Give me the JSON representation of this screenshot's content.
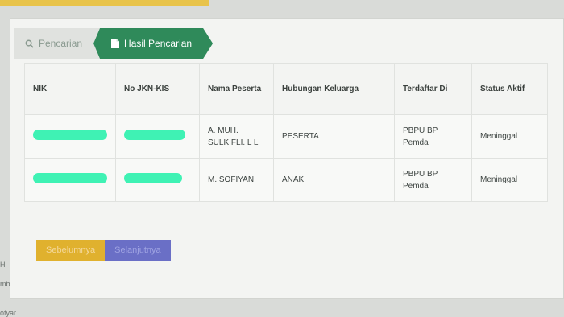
{
  "tabs": {
    "search_label": "Pencarian",
    "result_label": "Hasil Pencarian"
  },
  "table": {
    "headers": [
      "NIK",
      "No JKN-KIS",
      "Nama Peserta",
      "Hubungan Keluarga",
      "Terdaftar Di",
      "Status Aktif"
    ],
    "rows": [
      {
        "nama": "A. MUH. SULKIFLI. L L",
        "hubungan": "PESERTA",
        "terdaftar": "PBPU BP Pemda",
        "status": "Meninggal"
      },
      {
        "nama": "M. SOFIYAN",
        "hubungan": "ANAK",
        "terdaftar": "PBPU BP Pemda",
        "status": "Meninggal"
      }
    ]
  },
  "pager": {
    "prev_label": "Sebelumnya",
    "next_label": "Selanjutnya"
  },
  "side": {
    "line1": "Hi",
    "line2": "mb",
    "line3": "ofyar"
  },
  "colors": {
    "tab_active": "#2f8a5a",
    "redaction": "#3ff2b4",
    "prev_button": "#e0b12e",
    "next_button": "#6a6fc6"
  },
  "icons": {
    "search_tab": "search-icon",
    "result_tab": "document-icon"
  }
}
